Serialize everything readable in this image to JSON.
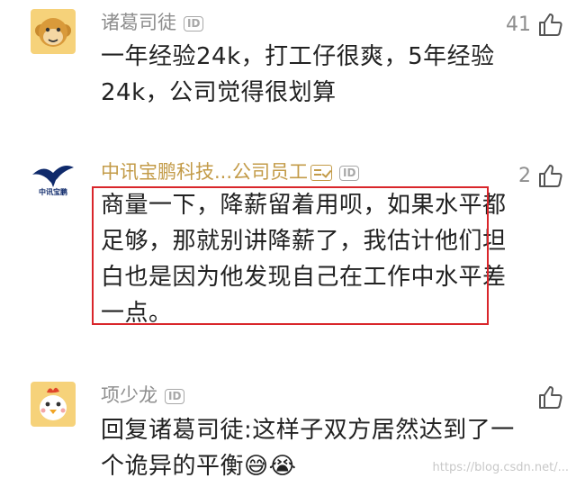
{
  "comments": [
    {
      "username": "诸葛司徒",
      "id_badge": "ID",
      "likes": "41",
      "text_lines": [
        "一年经验24k，打工仔很爽，5年经验",
        "24k，公司觉得很划算"
      ]
    },
    {
      "username": "中讯宝鹏科技...公司员工",
      "id_badge": "ID",
      "likes": "2",
      "logo_text": "中讯宝鹏",
      "text_lines": [
        "商量一下，降薪留着用呗，如果水平都",
        "足够，那就别讲降薪了，我估计他们坦",
        "白也是因为他发现自己在工作中水平差",
        "一点。"
      ]
    },
    {
      "username": "项少龙",
      "id_badge": "ID",
      "likes": "",
      "text_lines": [
        "回复诸葛司徒:这样子双方居然达到了一",
        "个诡异的平衡😅😭"
      ]
    }
  ],
  "watermark": "https://blog.csdn.net/...",
  "colors": {
    "company_name": "#c39b48",
    "highlight_border": "#d9262b",
    "username": "#8e8e8e"
  },
  "icons": {
    "like": "thumbs-up-icon"
  }
}
